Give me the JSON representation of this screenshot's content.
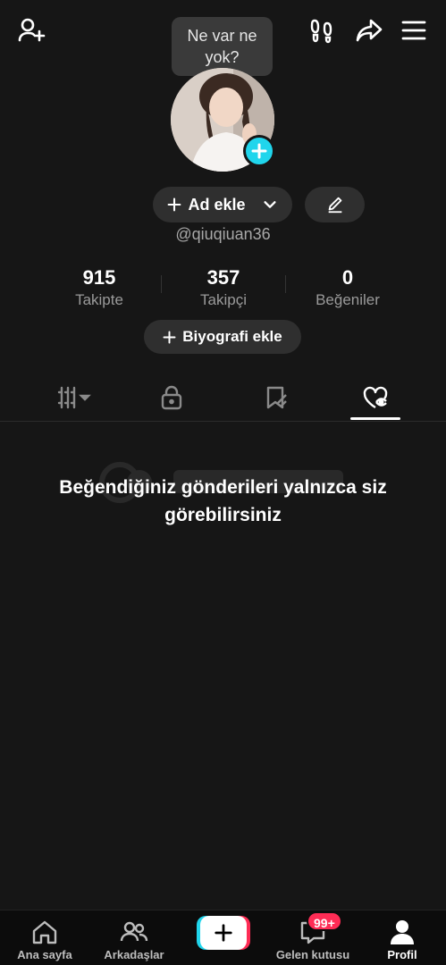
{
  "tooltip": {
    "text": "Ne var ne yok?"
  },
  "top_icons": [
    "add-friend-icon",
    "footprints-icon",
    "share-icon",
    "menu-icon"
  ],
  "profile": {
    "name_button": "Ad ekle",
    "handle": "@qiuqiuan36",
    "bio_button": "Biyografi ekle"
  },
  "stats": [
    {
      "value": "915",
      "label": "Takipte"
    },
    {
      "value": "357",
      "label": "Takipçi"
    },
    {
      "value": "0",
      "label": "Beğeniler"
    }
  ],
  "tabs": [
    "videos-grid-icon",
    "lock-icon",
    "bookmark-icon",
    "liked-heart-icon"
  ],
  "active_tab": 3,
  "empty_state": {
    "message": "Beğendiğiniz gönderileri yalnızca siz görebilirsiniz"
  },
  "bottom_nav": {
    "home": "Ana sayfa",
    "friends": "Arkadaşlar",
    "inbox": "Gelen kutusu",
    "inbox_badge": "99+",
    "profile": "Profil"
  },
  "colors": {
    "accent_cyan": "#20d5ec",
    "accent_red": "#fe2c55",
    "background": "#161616"
  }
}
